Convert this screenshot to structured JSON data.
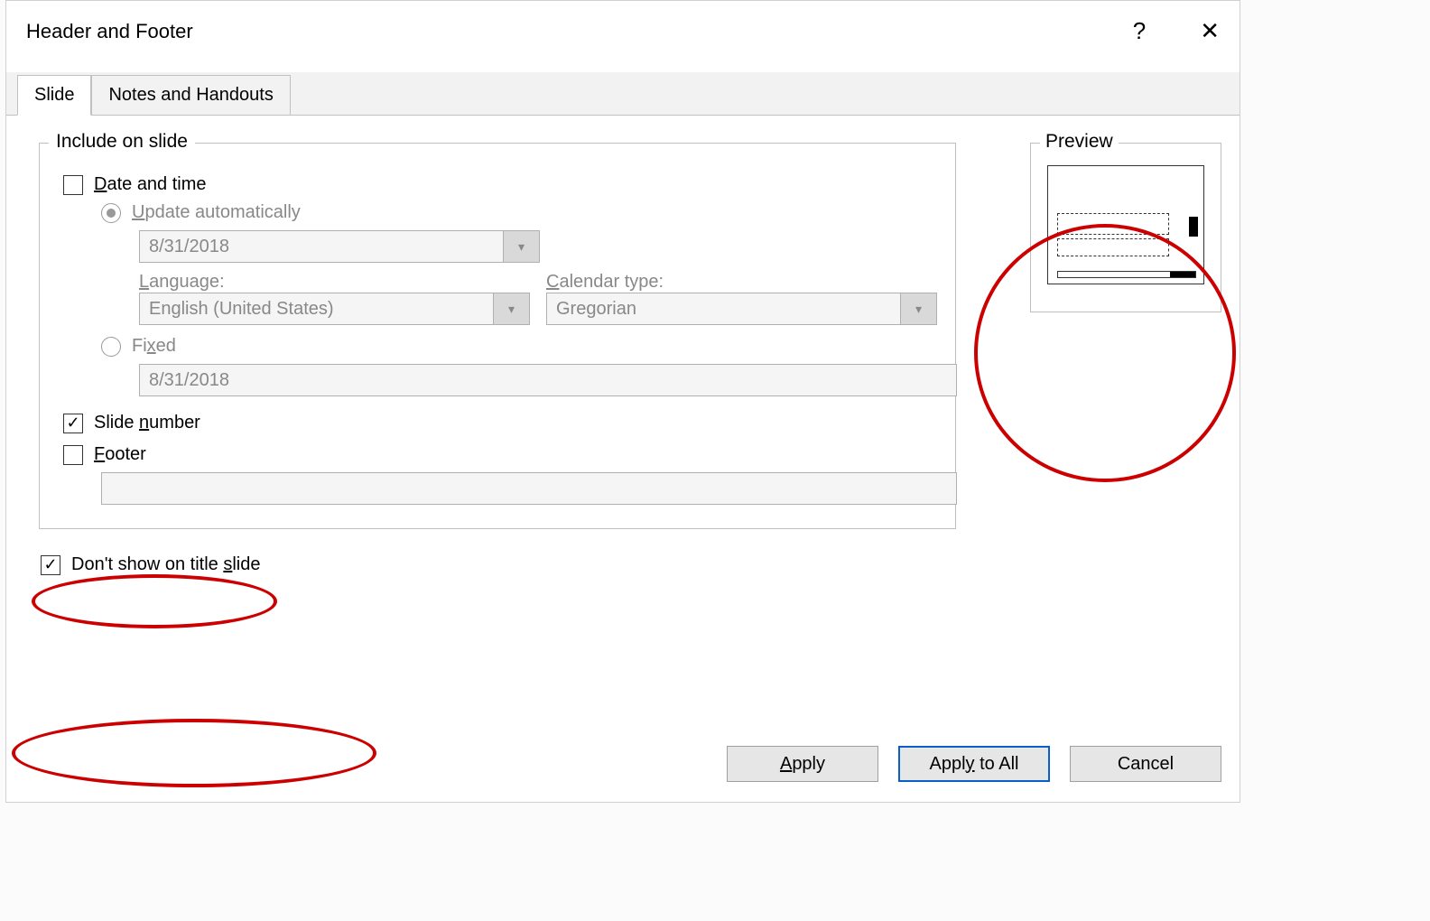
{
  "dialog": {
    "title": "Header and Footer",
    "help": "?",
    "close": "✕"
  },
  "tabs": {
    "slide": "Slide",
    "notes": "Notes and Handouts"
  },
  "include": {
    "legend": "Include on slide",
    "datetime": "Date and time",
    "update_auto": "Update automatically",
    "date_value": "8/31/2018",
    "language_label": "Language:",
    "language_value": "English (United States)",
    "calendar_label": "Calendar type:",
    "calendar_value": "Gregorian",
    "fixed": "Fixed",
    "fixed_value": "8/31/2018",
    "slide_number": "Slide number",
    "footer": "Footer",
    "footer_value": ""
  },
  "dont_show": "Don't show on title slide",
  "preview": {
    "legend": "Preview"
  },
  "buttons": {
    "apply": "Apply",
    "apply_all": "Apply to All",
    "cancel": "Cancel"
  },
  "state": {
    "datetime_checked": false,
    "auto_selected": true,
    "slide_number_checked": true,
    "footer_checked": false,
    "dont_show_checked": true
  }
}
